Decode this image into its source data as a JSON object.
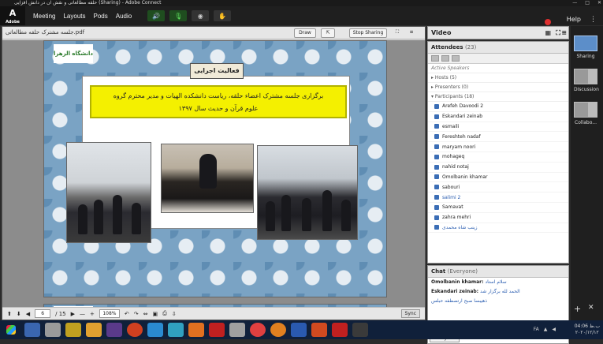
{
  "window": {
    "title": "حلقه مطالعاتی و نقش آن در دانش افزایی (Sharing) - Adobe Connect"
  },
  "logo": {
    "text": "A",
    "sub": "Adobe"
  },
  "menu": [
    "Meeting",
    "Layouts",
    "Pods",
    "Audio"
  ],
  "menu_right": {
    "help": "Help"
  },
  "share_pod": {
    "file_name": "جلسه مشترک حلقه مطالعاتی.pdf",
    "draw_label": "Draw",
    "stop_label": "Stop Sharing",
    "page_logo": "دانشگاه الزهرا",
    "page2_logo": "ا",
    "banner_tab": "فعالیت اجرایی",
    "headline_line1": "برگزاری جلسه مشترک اعضاء حلقه، ریاست دانشکده الهیات و مدیر محترم گروه",
    "headline_line2": "علوم قرآن و حدیث سال ۱۳۹۷",
    "page_current": "6",
    "page_total": "/ 15",
    "zoom": "108%",
    "sync_label": "Sync"
  },
  "video_pod": {
    "title": "Video"
  },
  "attendees": {
    "title": "Attendees",
    "count": "(23)",
    "active_speakers": "Active Speakers",
    "hosts": "Hosts (5)",
    "presenters": "Presenters (0)",
    "participants_label": "Participants (18)",
    "participants": [
      "Arefeh Davoodi 2",
      "Eskandari zeinab",
      "esmaili",
      "Fereshteh nadaf",
      "maryam noori",
      "mohageq",
      "nahid notaj",
      "Omolbanin khamar",
      "sabouri",
      "salimi 2",
      "Samavat",
      "zahra mehri",
      "زینب شاه محمدی"
    ]
  },
  "chat": {
    "title": "Chat",
    "scope": "(Everyone)",
    "messages": [
      {
        "from": "Omolbanin khamar:",
        "text": "سلام استاد"
      },
      {
        "from": "Eskandari zeinab:",
        "text": "الحمد لله برگزار شد"
      },
      {
        "from": "",
        "text": "ذهیبسا صبح ارتصطفه حبلس"
      }
    ],
    "tab": "Everyone"
  },
  "layouts": [
    {
      "label": "Sharing"
    },
    {
      "label": "Discussion"
    },
    {
      "label": "Collabo..."
    }
  ],
  "taskbar": {
    "lang": "FA",
    "time": "04:06 ب.ظ",
    "date": "۲۰۲۰/۱۲/۱۲"
  },
  "colors": {
    "accent": "#5c8ec9",
    "record": "#e03030",
    "headline_bg": "#f4f000"
  }
}
